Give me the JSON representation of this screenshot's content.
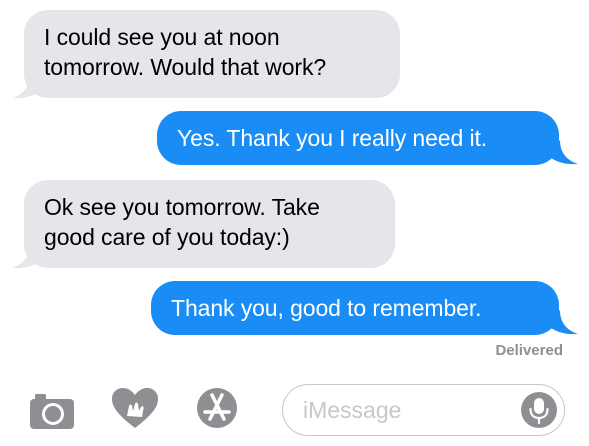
{
  "conversation": {
    "messages": [
      {
        "direction": "incoming",
        "text": "I could see you at noon\ntomorrow. Would that work?"
      },
      {
        "direction": "outgoing",
        "text": "Yes. Thank you I really need it."
      },
      {
        "direction": "incoming",
        "text": "Ok see you tomorrow. Take\ngood care of you today:)"
      },
      {
        "direction": "outgoing",
        "text": "Thank you, good to remember."
      }
    ],
    "status": "Delivered"
  },
  "composer": {
    "placeholder": "iMessage",
    "icons": [
      "camera-icon",
      "digital-touch-icon",
      "app-store-icon",
      "microphone-icon"
    ]
  },
  "colors": {
    "incoming_bubble": "#e5e5ea",
    "outgoing_bubble": "#1a8cf5",
    "icon_gray": "#8e8e93"
  }
}
